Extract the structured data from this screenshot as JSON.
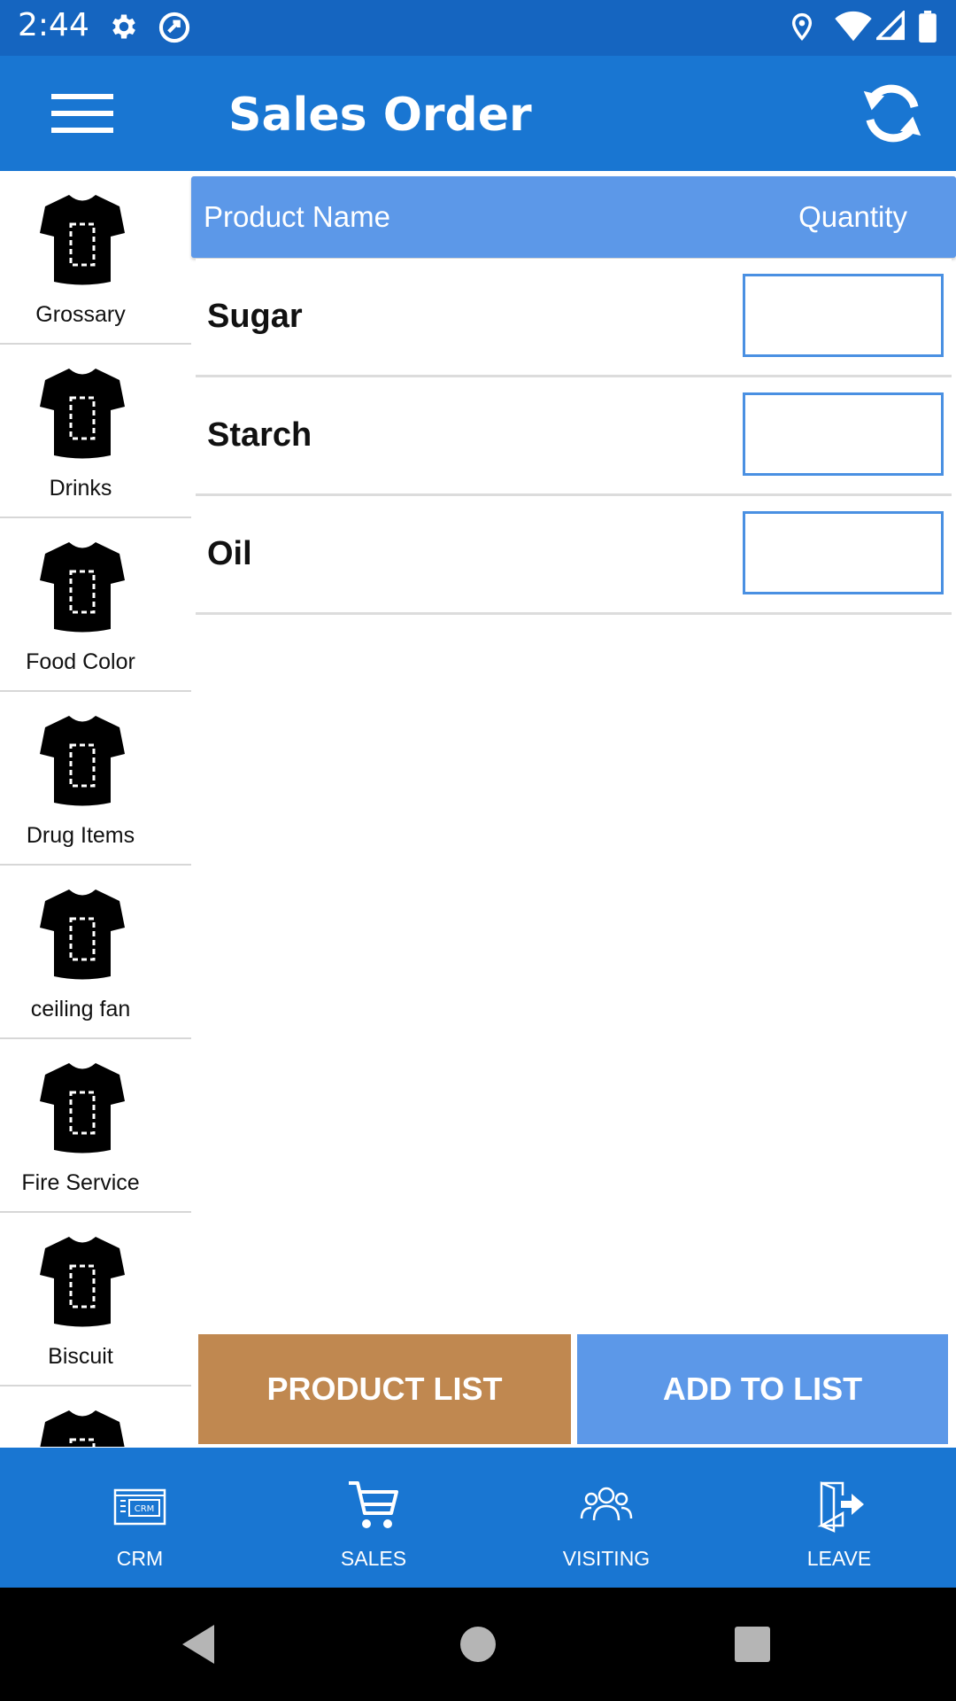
{
  "status_bar": {
    "time": "2:44",
    "icons": [
      "settings-icon",
      "sync-notification-icon",
      "location-icon",
      "wifi-icon",
      "signal-icon",
      "battery-icon"
    ]
  },
  "app_bar": {
    "title": "Sales Order",
    "menu_icon": "hamburger-menu-icon",
    "refresh_icon": "refresh-icon"
  },
  "sidebar": {
    "items": [
      {
        "label": "Grossary",
        "icon": "tshirt-icon"
      },
      {
        "label": "Drinks",
        "icon": "tshirt-icon"
      },
      {
        "label": "Food Color",
        "icon": "tshirt-icon"
      },
      {
        "label": "Drug Items",
        "icon": "tshirt-icon"
      },
      {
        "label": "ceiling fan",
        "icon": "tshirt-icon"
      },
      {
        "label": "Fire Service",
        "icon": "tshirt-icon"
      },
      {
        "label": "Biscuit",
        "icon": "tshirt-icon"
      },
      {
        "label": "",
        "icon": "tshirt-icon"
      }
    ]
  },
  "table": {
    "header": {
      "name": "Product Name",
      "quantity": "Quantity"
    },
    "rows": [
      {
        "name": "Sugar",
        "quantity": ""
      },
      {
        "name": "Starch",
        "quantity": ""
      },
      {
        "name": "Oil",
        "quantity": ""
      }
    ]
  },
  "actions": {
    "product_list": "PRODUCT LIST",
    "add_to_list": "ADD TO LIST"
  },
  "bottom_nav": {
    "items": [
      {
        "label": "CRM",
        "icon": "crm-icon"
      },
      {
        "label": "SALES",
        "icon": "cart-icon"
      },
      {
        "label": "VISITING",
        "icon": "people-icon"
      },
      {
        "label": "LEAVE",
        "icon": "exit-door-icon"
      }
    ]
  },
  "colors": {
    "status_bar": "#1565c0",
    "primary": "#1976d2",
    "table_header": "#5c98e8",
    "product_list_button": "#c08850",
    "add_to_list_button": "#5c98e8",
    "input_border": "#4a90e2"
  }
}
